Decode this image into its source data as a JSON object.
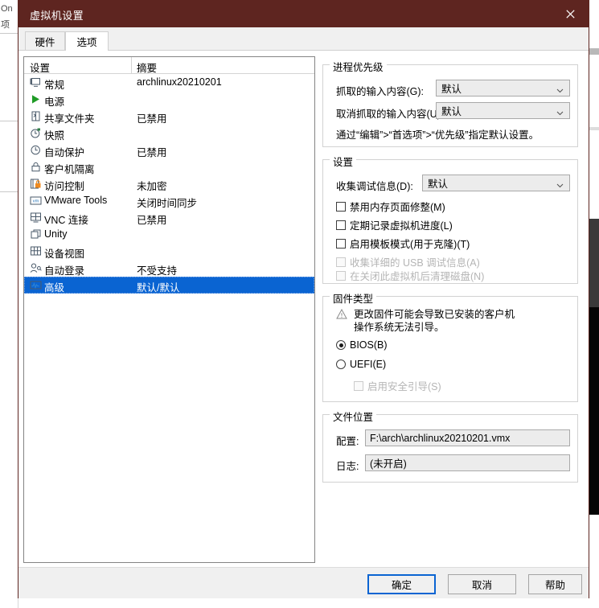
{
  "window": {
    "title": "虚拟机设置",
    "close_label": "✕"
  },
  "tabs": [
    {
      "label": "硬件",
      "active": false
    },
    {
      "label": "选项",
      "active": true
    }
  ],
  "settings_list": {
    "columns": {
      "name": "设置",
      "summary": "摘要"
    },
    "rows": [
      {
        "icon": "monitor-icon",
        "name": "常规",
        "summary": "archlinux20210201",
        "selected": false
      },
      {
        "icon": "power-play-icon",
        "name": "电源",
        "summary": "",
        "selected": false
      },
      {
        "icon": "shared-folder-icon",
        "name": "共享文件夹",
        "summary": "已禁用",
        "selected": false
      },
      {
        "icon": "snapshot-icon",
        "name": "快照",
        "summary": "",
        "selected": false
      },
      {
        "icon": "autoprotect-icon",
        "name": "自动保护",
        "summary": "已禁用",
        "selected": false
      },
      {
        "icon": "lock-icon",
        "name": "客户机隔离",
        "summary": "",
        "selected": false
      },
      {
        "icon": "access-control-icon",
        "name": "访问控制",
        "summary": "未加密",
        "selected": false
      },
      {
        "icon": "vmware-tools-icon",
        "name": "VMware Tools",
        "summary": "关闭时间同步",
        "selected": false
      },
      {
        "icon": "vnc-icon",
        "name": "VNC 连接",
        "summary": "已禁用",
        "selected": false
      },
      {
        "icon": "unity-icon",
        "name": "Unity",
        "summary": "",
        "selected": false
      },
      {
        "icon": "device-view-icon",
        "name": "设备视图",
        "summary": "",
        "selected": false
      },
      {
        "icon": "auto-login-icon",
        "name": "自动登录",
        "summary": "不受支持",
        "selected": false
      },
      {
        "icon": "advanced-icon",
        "name": "高级",
        "summary": "默认/默认",
        "selected": true
      }
    ]
  },
  "process_priority": {
    "legend": "进程优先级",
    "grab_label": "抓取的输入内容(G):",
    "grab_value": "默认",
    "ungrab_label": "取消抓取的输入内容(U):",
    "ungrab_value": "默认",
    "hint": "通过“编辑”>“首选项”>“优先级”指定默认设置。"
  },
  "settings_group": {
    "legend": "设置",
    "debug_label": "收集调试信息(D):",
    "debug_value": "默认",
    "checkboxes": [
      {
        "label": "禁用内存页面修整(M)",
        "checked": false,
        "disabled": false
      },
      {
        "label": "定期记录虚拟机进度(L)",
        "checked": false,
        "disabled": false
      },
      {
        "label": "启用模板模式(用于克隆)(T)",
        "checked": false,
        "disabled": false
      },
      {
        "label": "收集详细的 USB 调试信息(A)",
        "checked": false,
        "disabled": true
      },
      {
        "label": "在关闭此虚拟机后清理磁盘(N)",
        "checked": false,
        "disabled": true
      }
    ]
  },
  "firmware": {
    "legend": "固件类型",
    "warning": "更改固件可能会导致已安装的客户机\n操作系统无法引导。",
    "options": [
      {
        "label": "BIOS(B)",
        "checked": true
      },
      {
        "label": "UEFI(E)",
        "checked": false
      }
    ],
    "secure_boot": {
      "label": "启用安全引导(S)",
      "checked": false,
      "disabled": true
    }
  },
  "file_location": {
    "legend": "文件位置",
    "config_label": "配置:",
    "config_value": "F:\\arch\\archlinux20210201.vmx",
    "log_label": "日志:",
    "log_value": "(未开启)"
  },
  "footer": {
    "ok": "确定",
    "cancel": "取消",
    "help": "帮助"
  },
  "background": {
    "strip_text": "On",
    "strip_text2": "项"
  },
  "colors": {
    "titlebar": "#5e2520",
    "selection": "#0a64d2",
    "default_button_border": "#0a64d2"
  }
}
